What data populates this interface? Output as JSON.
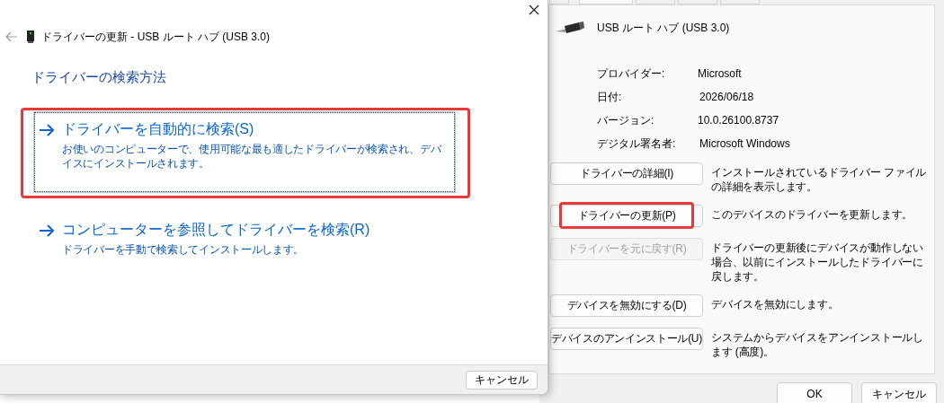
{
  "wizard": {
    "title": "ドライバーの更新 - USB ルート ハブ (USB 3.0)",
    "heading": "ドライバーの検索方法",
    "options": [
      {
        "title": "ドライバーを自動的に検索(S)",
        "description": "お使いのコンピューターで、使用可能な最も適したドライバーが検索され、デバイスにインストールされます。",
        "focused": true,
        "highlighted": true
      },
      {
        "title": "コンピューターを参照してドライバーを検索(R)",
        "description": "ドライバーを手動で検索してインストールします。",
        "focused": false,
        "highlighted": false
      }
    ],
    "cancel_button": "キャンセル"
  },
  "properties": {
    "tabs": [
      {
        "selected": false
      },
      {
        "selected": true
      },
      {
        "selected": false
      },
      {
        "selected": false
      },
      {
        "selected": false
      }
    ],
    "device_name": "USB ルート ハブ (USB 3.0)",
    "fields": [
      {
        "label": "プロバイダー:",
        "value": "Microsoft"
      },
      {
        "label": "日付:",
        "value": "2026/06/18"
      },
      {
        "label": "バージョン:",
        "value": "10.0.26100.8737"
      },
      {
        "label": "デジタル署名者:",
        "value": "Microsoft Windows"
      }
    ],
    "actions": [
      {
        "button": "ドライバーの詳細(I)",
        "description": "インストールされているドライバー ファイルの詳細を表示します。",
        "disabled": false,
        "highlighted": false
      },
      {
        "button": "ドライバーの更新(P)",
        "description": "このデバイスのドライバーを更新します。",
        "disabled": false,
        "highlighted": true
      },
      {
        "button": "ドライバーを元に戻す(R)",
        "description": "ドライバーの更新後にデバイスが動作しない場合、以前にインストールしたドライバーに戻します。",
        "disabled": true,
        "highlighted": false
      },
      {
        "button": "デバイスを無効にする(D)",
        "description": "デバイスを無効にします。",
        "disabled": false,
        "highlighted": false
      },
      {
        "button": "デバイスのアンインストール(U)",
        "description": "システムからデバイスをアンインストールします (高度)。",
        "disabled": false,
        "highlighted": false
      }
    ],
    "buttons": [
      "OK",
      "キャンセル"
    ]
  }
}
